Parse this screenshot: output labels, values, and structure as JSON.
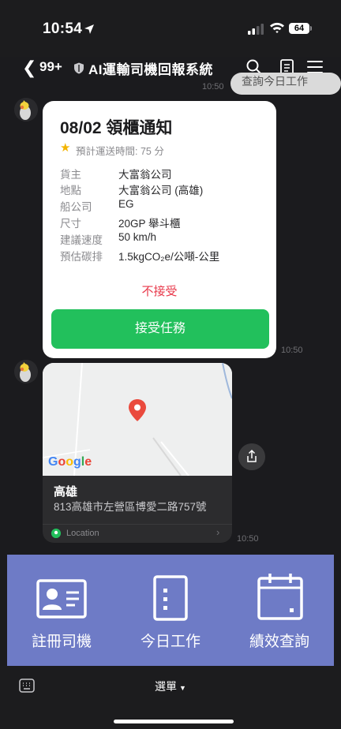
{
  "status_bar": {
    "time": "10:54",
    "battery": "64"
  },
  "header": {
    "back_count": "99+",
    "title": "AI運輸司機回報系統"
  },
  "prev_message": {
    "text": "查詢今日工作",
    "time": "10:50"
  },
  "task_card": {
    "title": "08/02 領櫃通知",
    "eta": "預計運送時間: 75 分",
    "fields": [
      {
        "label": "貨主",
        "value": "大富翁公司"
      },
      {
        "label": "地點",
        "value": "大富翁公司 (高雄)"
      },
      {
        "label": "船公司",
        "value": "EG"
      },
      {
        "label": "尺寸",
        "value": "20GP 舉斗櫃"
      },
      {
        "label": "建議速度",
        "value": "50 km/h"
      },
      {
        "label": "預估碳排",
        "value": "1.5kgCO₂e/公噸-公里"
      }
    ],
    "decline_label": "不接受",
    "accept_label": "接受任務",
    "time": "10:50"
  },
  "location_card": {
    "map_brand": "Google",
    "name": "高雄",
    "address": "813高雄市左營區博愛二路757號",
    "label": "Location",
    "time": "10:50"
  },
  "rich_menu": {
    "items": [
      {
        "label": "註冊司機",
        "icon": "id-card-icon"
      },
      {
        "label": "今日工作",
        "icon": "document-list-icon"
      },
      {
        "label": "績效查詢",
        "icon": "calendar-icon"
      }
    ]
  },
  "bottom_bar": {
    "menu_label": "選單"
  }
}
